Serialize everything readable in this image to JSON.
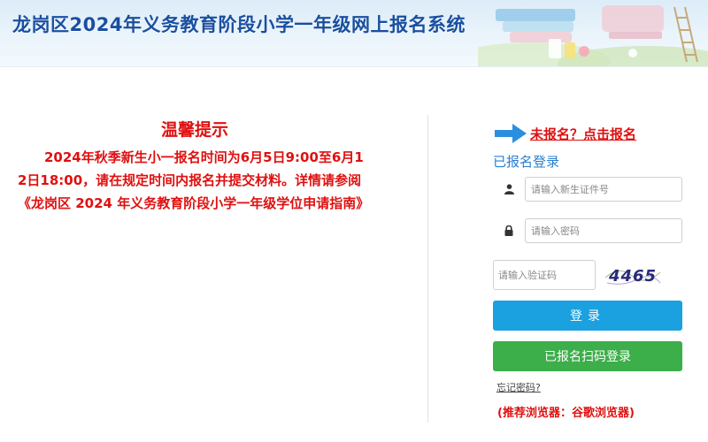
{
  "header": {
    "title": "龙岗区2024年义务教育阶段小学一年级网上报名系统"
  },
  "notice": {
    "title": "温馨提示",
    "body": "2024年秋季新生小一报名时间为6月5日9:00至6月12日18:00，请在规定时间内报名并提交材料。详情请参阅《龙岗区 2024 年义务教育阶段小学一年级学位申请指南》"
  },
  "login": {
    "register_link": "未报名？点击报名",
    "section_title": "已报名登录",
    "id_placeholder": "请输入新生证件号",
    "password_placeholder": "请输入密码",
    "captcha_placeholder": "请输入验证码",
    "captcha_text": "4465",
    "login_button": "登录",
    "scan_login_button": "已报名扫码登录",
    "forgot_password": "忘记密码?",
    "browser_tip_open": "(",
    "browser_tip_label": "推荐浏览器：",
    "browser_tip_value": "谷歌浏览器",
    "browser_tip_close": ")"
  },
  "colors": {
    "title_blue": "#1a4fa0",
    "alert_red": "#e01010",
    "login_blue": "#1ba0e0",
    "scan_green": "#3cae4a"
  },
  "icons": {
    "user": "user-icon",
    "lock": "lock-icon",
    "arrow": "arrow-right-icon"
  }
}
